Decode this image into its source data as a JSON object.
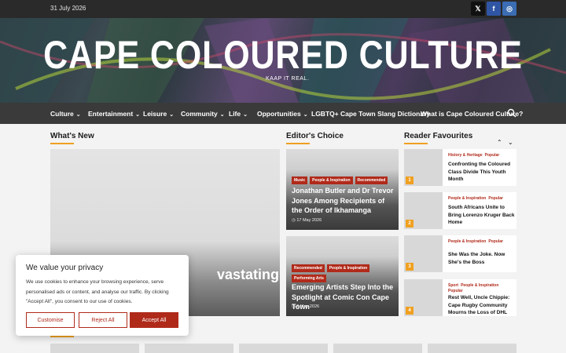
{
  "topbar": {
    "date": "31 July 2026"
  },
  "social": [
    {
      "label": "𝕏",
      "icon": "x-icon"
    },
    {
      "label": "f",
      "icon": "facebook-icon"
    },
    {
      "label": "◎",
      "icon": "instagram-icon"
    }
  ],
  "site": {
    "title": "CAPE COLOURED CULTURE",
    "tagline": "KAAP IT REAL."
  },
  "nav": {
    "items": [
      {
        "label": "Culture",
        "dropdown": true
      },
      {
        "label": "Entertainment",
        "dropdown": true
      },
      {
        "label": "Leisure",
        "dropdown": true
      },
      {
        "label": "Community",
        "dropdown": true
      },
      {
        "label": "Life",
        "dropdown": true
      },
      {
        "label": "Opportunities",
        "dropdown": true
      },
      {
        "label": "LGBTQ+",
        "dropdown": false
      },
      {
        "label": "Cape Town Slang Dictionary",
        "dropdown": false
      },
      {
        "label": "What is Cape Coloured Culture?",
        "dropdown": false
      }
    ],
    "chevron": "⌄"
  },
  "sections": {
    "whats_new": "What's New",
    "editors_choice": "Editor's Choice",
    "reader_favourites": "Reader Favourites"
  },
  "hero": {
    "title_fragment": "vastating"
  },
  "editors": [
    {
      "tags": [
        "Music",
        "People & Inspiration",
        "Recommended"
      ],
      "title": "Jonathan Butler and Dr Trevor Jones Among Recipients of the Order of Ikhamanga",
      "date": "17 May 2026"
    },
    {
      "tags": [
        "Recommended",
        "People & Inspiration",
        "Performing Arts"
      ],
      "title": "Emerging Artists Step Into the Spotlight at Comic Con Cape Town",
      "date": "6 May 2026"
    }
  ],
  "favourites": {
    "prev": "⌃",
    "next": "⌄",
    "items": [
      {
        "num": "1",
        "tags": [
          "History & Heritage",
          "Popular"
        ],
        "title": "Confronting the Coloured Class Divide This Youth Month"
      },
      {
        "num": "2",
        "tags": [
          "People & Inspiration",
          "Popular"
        ],
        "title": "South Africans Unite to Bring Lorenzo Kruger Back Home"
      },
      {
        "num": "3",
        "tags": [
          "People & Inspiration",
          "Popular"
        ],
        "title": "She Was the Joke. Now She's the Boss"
      },
      {
        "num": "4",
        "tags": [
          "Sport",
          "People & Inspiration",
          "Popular"
        ],
        "title": "Rest Well, Uncle Chippie: Cape Rugby Community Mourns the Loss of DHL"
      }
    ]
  },
  "cookie": {
    "title": "We value your privacy",
    "body": "We use cookies to enhance your browsing experience, serve personalised ads or content, and analyse our traffic. By clicking \"Accept All\", you consent to our use of cookies.",
    "customise": "Customise",
    "reject": "Reject All",
    "accept": "Accept All"
  },
  "colors": {
    "accent": "#f0a020",
    "tag": "#b02a1a",
    "nav": "#3a3a3a",
    "topbar": "#2a2a2a"
  }
}
